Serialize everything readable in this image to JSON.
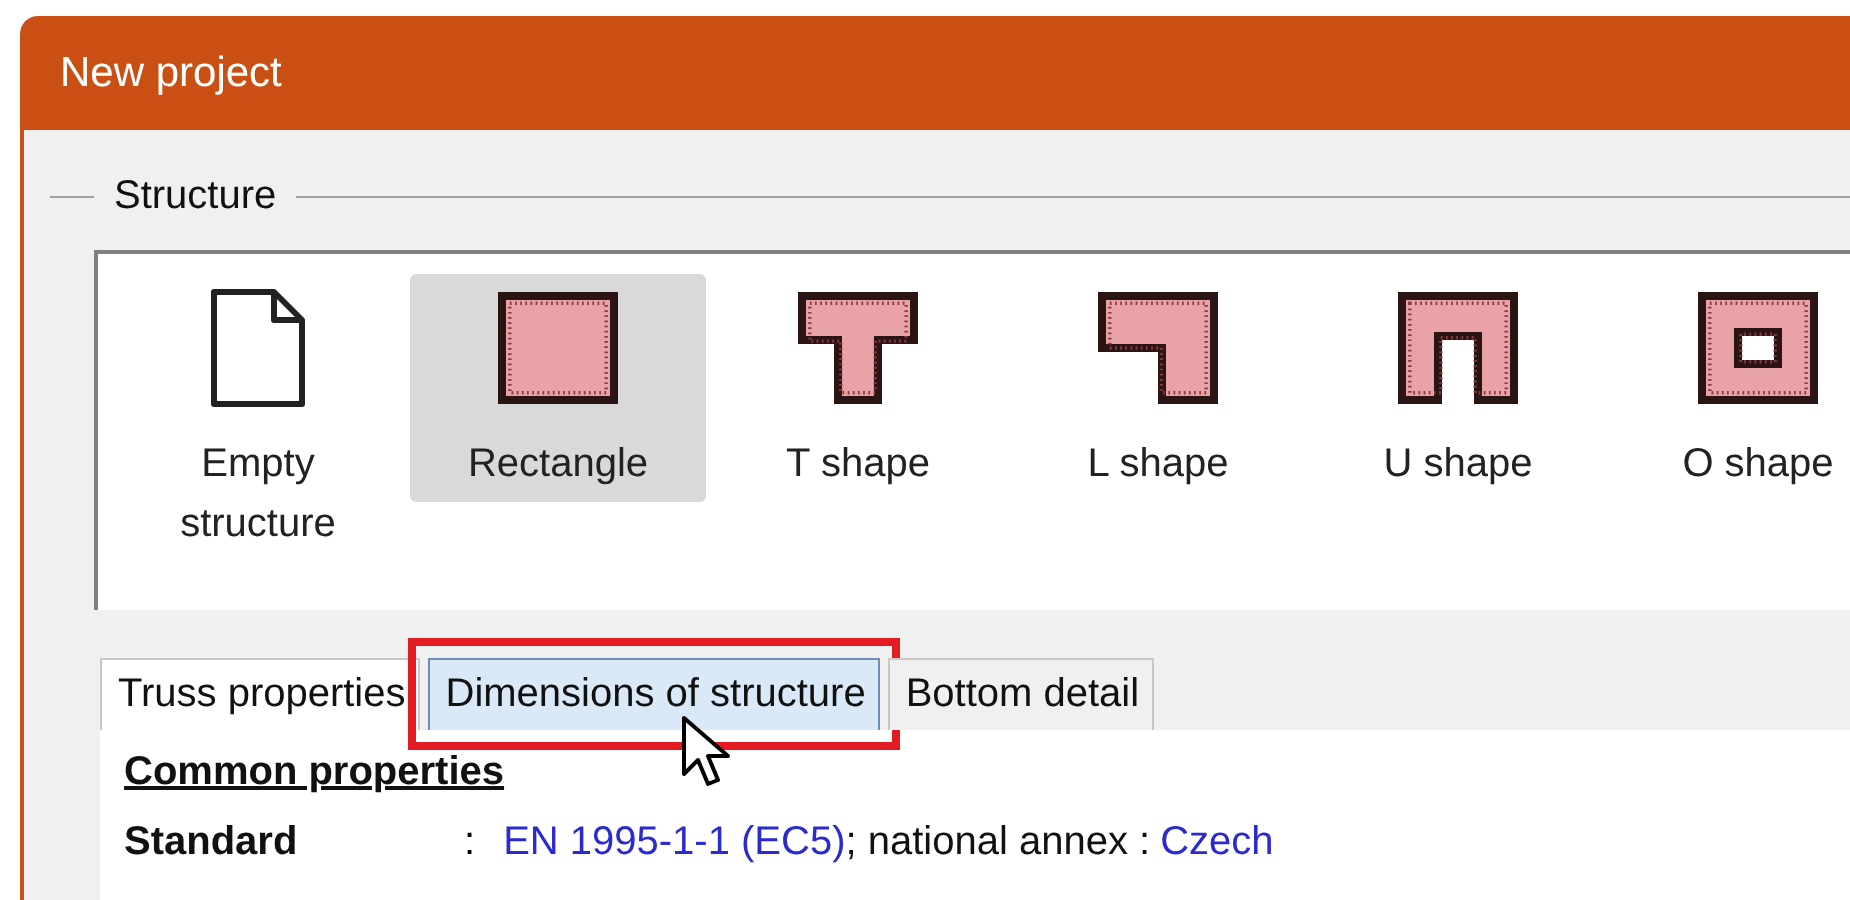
{
  "window": {
    "title": "New project"
  },
  "structure": {
    "legend": "Structure",
    "items": [
      {
        "kind": "empty",
        "label": "Empty structure",
        "selected": false
      },
      {
        "kind": "rectangle",
        "label": "Rectangle",
        "selected": true
      },
      {
        "kind": "t",
        "label": "T shape",
        "selected": false
      },
      {
        "kind": "l",
        "label": "L shape",
        "selected": false
      },
      {
        "kind": "u",
        "label": "U shape",
        "selected": false
      },
      {
        "kind": "o",
        "label": "O shape",
        "selected": false
      }
    ]
  },
  "tabs": [
    {
      "label": "Truss properties",
      "selected": true,
      "hovered": false,
      "highlighted": false
    },
    {
      "label": "Dimensions of structure",
      "selected": false,
      "hovered": true,
      "highlighted": true
    },
    {
      "label": "Bottom detail",
      "selected": false,
      "hovered": false,
      "highlighted": false
    }
  ],
  "panel": {
    "heading": "Common properties",
    "standard_label": "Standard",
    "separator": ":",
    "standard_value": "EN 1995-1-1 (EC5)",
    "annex_label": "; national annex :",
    "annex_value": "Czech"
  }
}
